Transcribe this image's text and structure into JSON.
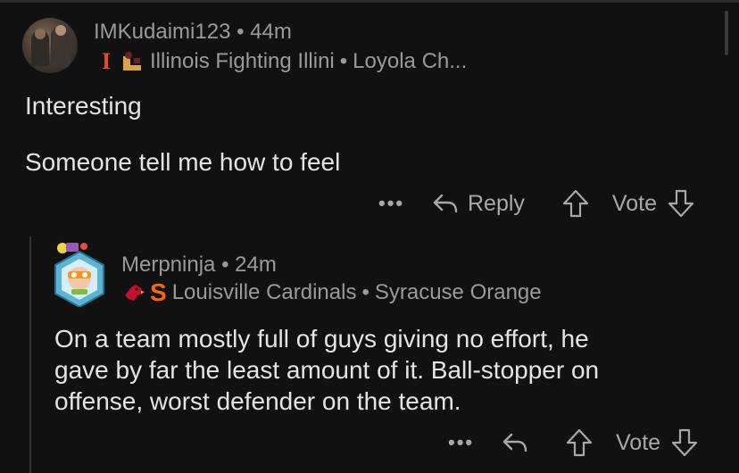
{
  "top_comment": {
    "username": "IMKudaimi123",
    "age": "44m",
    "flair_primary": "Illinois Fighting Illini",
    "flair_secondary": "Loyola Ch...",
    "lines": [
      "Interesting",
      "Someone tell me how to feel"
    ],
    "actions": {
      "more": "•••",
      "reply": "Reply",
      "vote": "Vote"
    }
  },
  "reply_comment": {
    "username": "Merpninja",
    "age": "24m",
    "flair_primary": "Louisville Cardinals",
    "flair_secondary": "Syracuse Orange",
    "flair_letter": "S",
    "lines": [
      "On a team mostly full of guys giving no effort, he",
      "gave by far the least amount of it. Ball-stopper on",
      "offense, worst defender on the team."
    ],
    "actions": {
      "more": "•••",
      "vote": "Vote"
    }
  },
  "separator": "•",
  "colors": {
    "background": "#111111",
    "illinois_orange": "#e84a27",
    "louisville_red": "#c8102e",
    "syracuse_orange": "#f76900",
    "text_primary": "#e4e4e4",
    "text_secondary": "#9a9a9a"
  },
  "icons": [
    "ellipsis-icon",
    "reply-arrow-icon",
    "upvote-icon",
    "downvote-icon"
  ]
}
